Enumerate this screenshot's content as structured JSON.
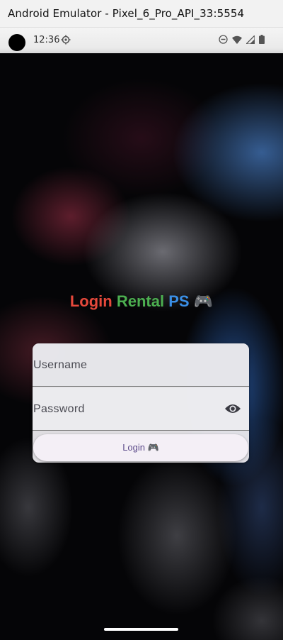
{
  "window": {
    "title": "Android Emulator - Pixel_6_Pro_API_33:5554"
  },
  "statusbar": {
    "time": "12:36",
    "icons": [
      "camera-cutout",
      "settings-gear-icon",
      "do-not-disturb-icon",
      "wifi-icon",
      "signal-icon",
      "battery-icon"
    ]
  },
  "app": {
    "heading": {
      "part1": "Login",
      "part2": "Rental",
      "part3": "PS",
      "emoji": "🎮"
    },
    "heading_colors": {
      "part1": "#e5483b",
      "part2": "#4caf50",
      "part3": "#3a8fe6"
    },
    "username": {
      "placeholder": "Username",
      "value": ""
    },
    "password": {
      "placeholder": "Password",
      "value": "",
      "toggle_icon": "eye-icon"
    },
    "login_button": {
      "label": "Login 🎮"
    },
    "accent_color": "#5c4a8a"
  }
}
